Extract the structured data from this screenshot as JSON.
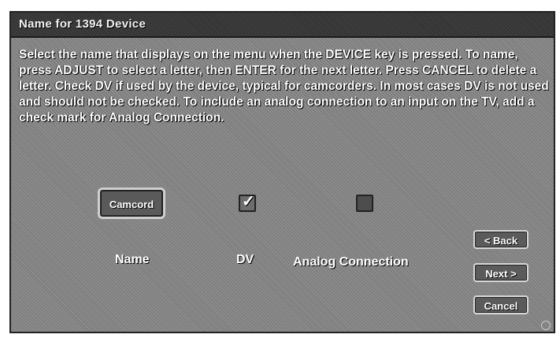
{
  "window": {
    "title": "Name for 1394 Device"
  },
  "instructions": "Select the name that displays on the menu when the DEVICE key is pressed.  To name, press ADJUST to select a letter, then ENTER for the next letter. Press CANCEL to delete a letter. Check DV if used by the device, typical for camcorders.  In most cases DV is not used and should not be checked.  To include an analog connection to an input on the TV, add a check mark for Analog Connection.",
  "fields": {
    "name_value": "Camcord",
    "name_label": "Name",
    "dv_label": "DV",
    "dv_checked": true,
    "dv_check_glyph": "✓",
    "analog_label": "Analog Connection",
    "analog_checked": false
  },
  "buttons": {
    "back": "< Back",
    "next": "Next >",
    "cancel": "Cancel"
  },
  "icons": {
    "checkmark": "check-icon",
    "corner_mark": "copyright-icon"
  }
}
